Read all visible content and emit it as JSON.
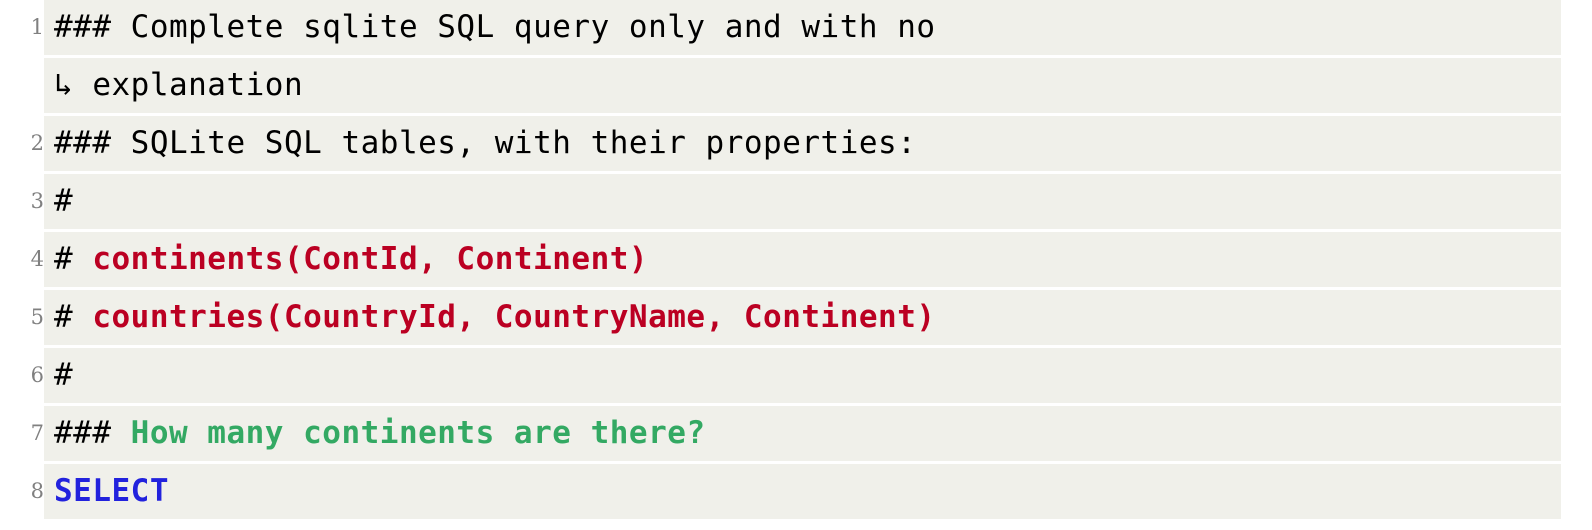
{
  "listing": {
    "language": "sqlite",
    "background_color": "#f0f0ea",
    "page_background_color": "#ffffff",
    "linenumber_color": "#808080",
    "wrap_marker": "↳",
    "colors": {
      "plain": "#000000",
      "table": "#bb0022",
      "question": "#33a963",
      "keyword": "#2222dd"
    },
    "rows": [
      {
        "number": "1",
        "is_wrap": false,
        "tokens": [
          {
            "text": "### Complete sqlite SQL query only and with no",
            "style": "plain"
          }
        ]
      },
      {
        "number": "",
        "is_wrap": true,
        "tokens": [
          {
            "text": "↳ explanation",
            "style": "wrap"
          }
        ]
      },
      {
        "number": "2",
        "is_wrap": false,
        "tokens": [
          {
            "text": "### SQLite SQL tables, with their properties:",
            "style": "plain"
          }
        ]
      },
      {
        "number": "3",
        "is_wrap": false,
        "tokens": [
          {
            "text": "#",
            "style": "plain"
          }
        ]
      },
      {
        "number": "4",
        "is_wrap": false,
        "tokens": [
          {
            "text": "# ",
            "style": "plain"
          },
          {
            "text": "continents(ContId, Continent)",
            "style": "table"
          }
        ]
      },
      {
        "number": "5",
        "is_wrap": false,
        "tokens": [
          {
            "text": "# ",
            "style": "plain"
          },
          {
            "text": "countries(CountryId, CountryName, Continent)",
            "style": "table"
          }
        ]
      },
      {
        "number": "6",
        "is_wrap": false,
        "tokens": [
          {
            "text": "#",
            "style": "plain"
          }
        ]
      },
      {
        "number": "7",
        "is_wrap": false,
        "tokens": [
          {
            "text": "### ",
            "style": "plain"
          },
          {
            "text": "How many continents are there?",
            "style": "question"
          }
        ]
      },
      {
        "number": "8",
        "is_wrap": false,
        "tokens": [
          {
            "text": "SELECT",
            "style": "keyword"
          }
        ]
      }
    ]
  }
}
